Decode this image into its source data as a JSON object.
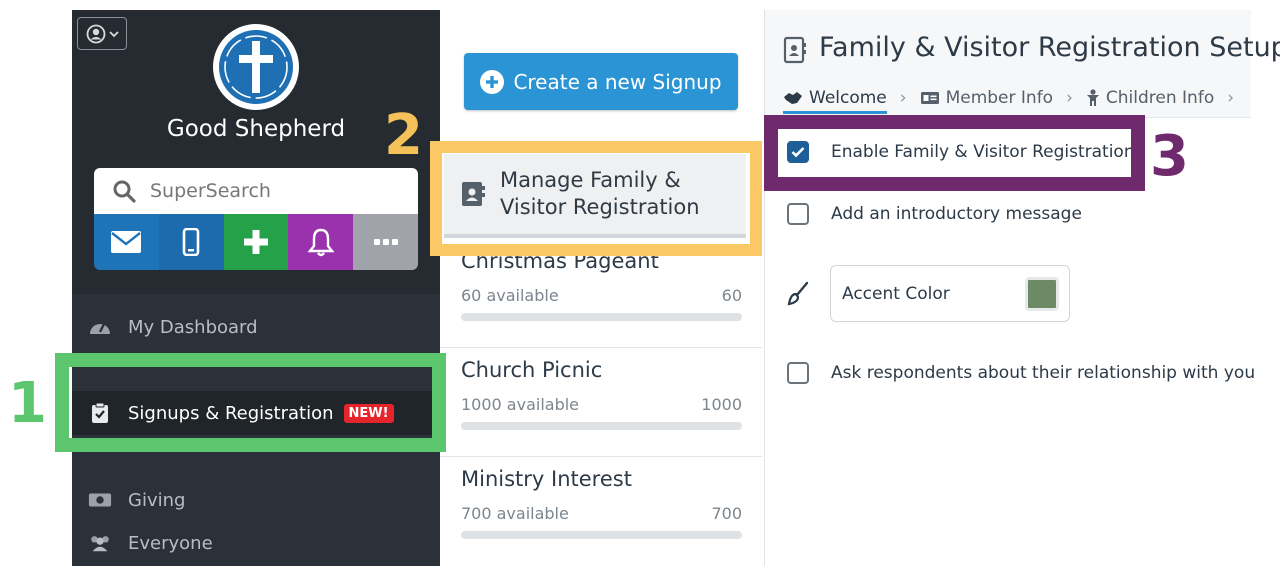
{
  "sidebar": {
    "church_name": "Good Shepherd",
    "search_placeholder": "SuperSearch",
    "quick_action_colors": [
      "#1f73b7",
      "#1d6aad",
      "#25a14a",
      "#9b32ad",
      "#a0a4aa"
    ],
    "nav": {
      "dashboard": "My Dashboard",
      "signups": "Signups & Registration",
      "signups_badge": "NEW!",
      "giving": "Giving",
      "everyone": "Everyone"
    }
  },
  "middle": {
    "create_label": "Create a new Signup",
    "manage_line1": "Manage Family &",
    "manage_line2": "Visitor Registration",
    "signups": [
      {
        "name": "Christmas Pageant",
        "available": "60 available",
        "count": "60"
      },
      {
        "name": "Church Picnic",
        "available": "1000 available",
        "count": "1000"
      },
      {
        "name": "Ministry Interest",
        "available": "700 available",
        "count": "700"
      }
    ]
  },
  "right": {
    "title": "Family & Visitor Registration Setup",
    "crumbs": [
      "Welcome",
      "Member Info",
      "Children Info"
    ],
    "options": {
      "enable": "Enable Family & Visitor Registration",
      "intro": "Add an introductory message",
      "accent": "Accent Color",
      "relationship": "Ask respondents about their relationship with you"
    },
    "accent_color": "#6c8a65"
  },
  "callouts": [
    "1",
    "2",
    "3"
  ]
}
